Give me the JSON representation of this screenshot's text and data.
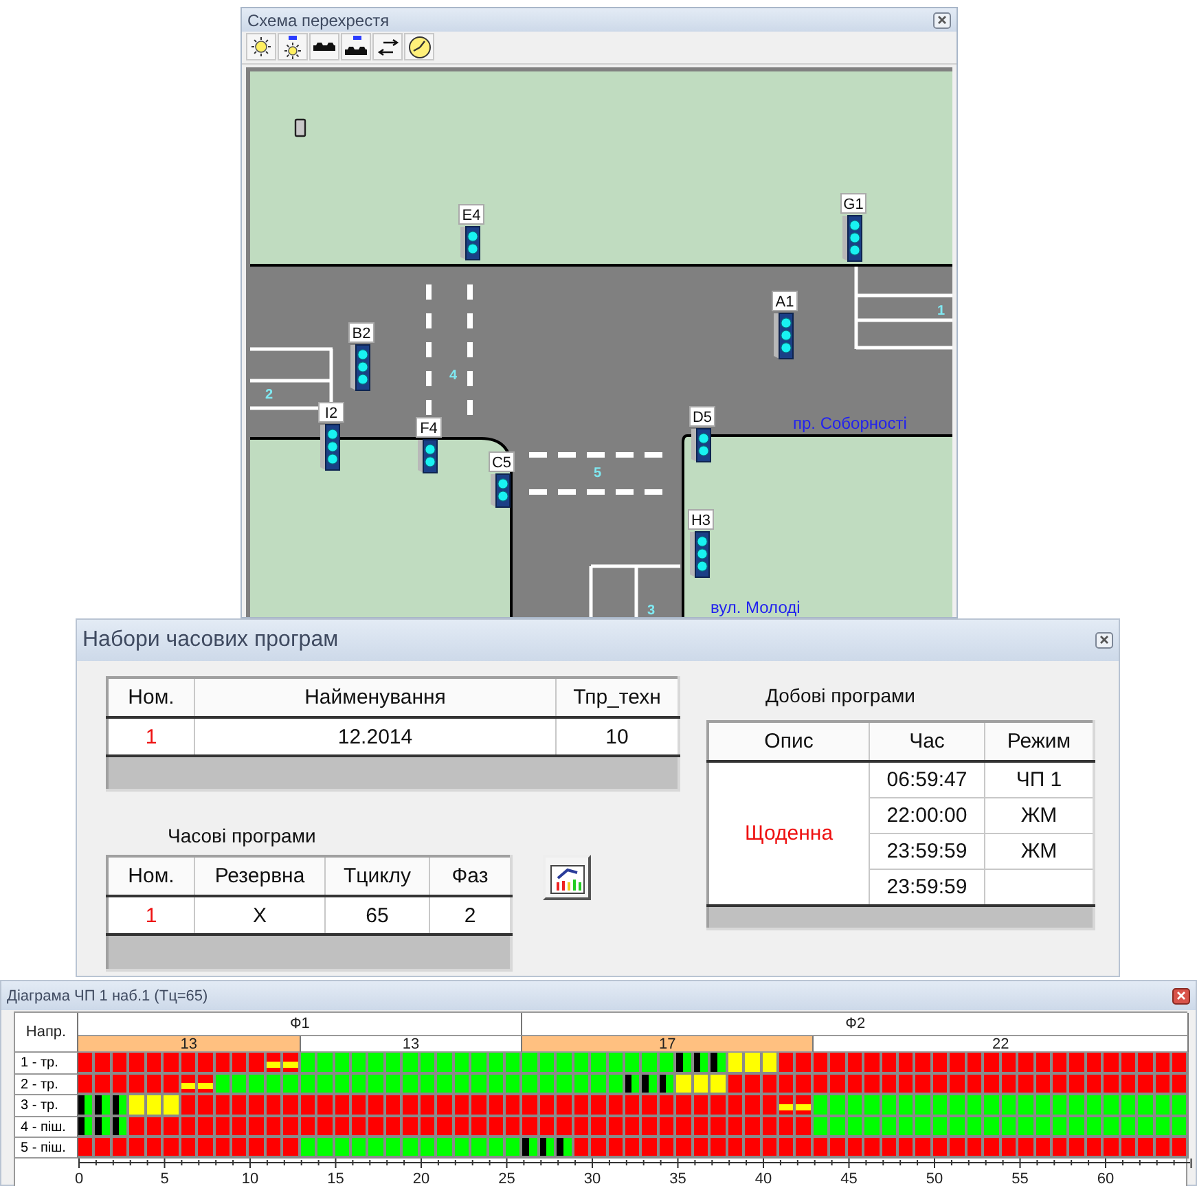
{
  "intersection_window": {
    "title": "Схема перехрестя",
    "toolbar": [
      {
        "kind": "sun"
      },
      {
        "kind": "sunlabeled"
      },
      {
        "kind": "cars"
      },
      {
        "kind": "carslabeled"
      },
      {
        "kind": "swap"
      },
      {
        "kind": "clock"
      }
    ],
    "map": {
      "lanes": [
        "1",
        "2",
        "3",
        "4",
        "5"
      ],
      "streets": [
        "пр. Соборності",
        "вул. Молоді"
      ],
      "signals": [
        {
          "label": "G1",
          "kind": "vehicle"
        },
        {
          "label": "E4",
          "kind": "pedestrian"
        },
        {
          "label": "A1",
          "kind": "vehicle"
        },
        {
          "label": "B2",
          "kind": "vehicle"
        },
        {
          "label": "I2",
          "kind": "vehicle"
        },
        {
          "label": "D5",
          "kind": "pedestrian"
        },
        {
          "label": "F4",
          "kind": "pedestrian"
        },
        {
          "label": "C5",
          "kind": "pedestrian"
        },
        {
          "label": "H3",
          "kind": "vehicle"
        }
      ]
    }
  },
  "programs_window": {
    "title": "Набори часових програм",
    "sets_table": {
      "columns": [
        "Ном.",
        "Найменування",
        "Тпр_техн"
      ],
      "rows": [
        [
          "1",
          "12.2014",
          "10"
        ]
      ]
    },
    "time_programs": {
      "title": "Часові програми",
      "columns": [
        "Ном.",
        "Резервна",
        "Тциклу",
        "Фаз"
      ],
      "rows": [
        [
          "1",
          "X",
          "65",
          "2"
        ]
      ]
    },
    "daily_programs": {
      "title": "Добові програми",
      "columns": [
        "Опис",
        "Час",
        "Режим"
      ],
      "description": "Щоденна",
      "rows": [
        {
          "time": "06:59:47",
          "mode": "ЧП 1"
        },
        {
          "time": "22:00:00",
          "mode": "ЖМ"
        },
        {
          "time": "23:59:59",
          "mode": "ЖМ"
        },
        {
          "time": "23:59:59"
        }
      ]
    }
  },
  "diagram_window": {
    "title": "Діаграма ЧП 1 наб.1 (Тц=65)",
    "direction_header": "Напр.",
    "phases": [
      {
        "label": "Ф1",
        "segments": [
          {
            "label": "13",
            "kind": "intermediate"
          },
          {
            "label": "13",
            "kind": "main"
          }
        ]
      },
      {
        "label": "Ф2",
        "segments": [
          {
            "label": "17",
            "kind": "intermediate"
          },
          {
            "label": "22",
            "kind": "main"
          }
        ]
      }
    ],
    "directions": [
      {
        "label": "1 - тр.",
        "cells": [
          {
            "kind": "red"
          },
          {
            "kind": "red"
          },
          {
            "kind": "red"
          },
          {
            "kind": "red"
          },
          {
            "kind": "red"
          },
          {
            "kind": "red"
          },
          {
            "kind": "red"
          },
          {
            "kind": "red"
          },
          {
            "kind": "red"
          },
          {
            "kind": "red"
          },
          {
            "kind": "red"
          },
          {
            "kind": "redyellow"
          },
          {
            "kind": "redyellow"
          },
          {
            "kind": "green"
          },
          {
            "kind": "green"
          },
          {
            "kind": "green"
          },
          {
            "kind": "green"
          },
          {
            "kind": "green"
          },
          {
            "kind": "green"
          },
          {
            "kind": "green"
          },
          {
            "kind": "green"
          },
          {
            "kind": "green"
          },
          {
            "kind": "green"
          },
          {
            "kind": "green"
          },
          {
            "kind": "green"
          },
          {
            "kind": "green"
          },
          {
            "kind": "green"
          },
          {
            "kind": "green"
          },
          {
            "kind": "green"
          },
          {
            "kind": "green"
          },
          {
            "kind": "green"
          },
          {
            "kind": "green"
          },
          {
            "kind": "green"
          },
          {
            "kind": "green"
          },
          {
            "kind": "green"
          },
          {
            "kind": "flash"
          },
          {
            "kind": "flash"
          },
          {
            "kind": "flash"
          },
          {
            "kind": "yellow"
          },
          {
            "kind": "yellow"
          },
          {
            "kind": "yellow"
          },
          {
            "kind": "red"
          },
          {
            "kind": "red"
          },
          {
            "kind": "red"
          },
          {
            "kind": "red"
          },
          {
            "kind": "red"
          },
          {
            "kind": "red"
          },
          {
            "kind": "red"
          },
          {
            "kind": "red"
          },
          {
            "kind": "red"
          },
          {
            "kind": "red"
          },
          {
            "kind": "red"
          },
          {
            "kind": "red"
          },
          {
            "kind": "red"
          },
          {
            "kind": "red"
          },
          {
            "kind": "red"
          },
          {
            "kind": "red"
          },
          {
            "kind": "red"
          },
          {
            "kind": "red"
          },
          {
            "kind": "red"
          },
          {
            "kind": "red"
          },
          {
            "kind": "red"
          },
          {
            "kind": "red"
          },
          {
            "kind": "red"
          },
          {
            "kind": "red"
          }
        ]
      },
      {
        "label": "2 - тр.",
        "cells": [
          {
            "kind": "red"
          },
          {
            "kind": "red"
          },
          {
            "kind": "red"
          },
          {
            "kind": "red"
          },
          {
            "kind": "red"
          },
          {
            "kind": "red"
          },
          {
            "kind": "redyellow"
          },
          {
            "kind": "redyellow"
          },
          {
            "kind": "green"
          },
          {
            "kind": "green"
          },
          {
            "kind": "green"
          },
          {
            "kind": "green"
          },
          {
            "kind": "green"
          },
          {
            "kind": "green"
          },
          {
            "kind": "green"
          },
          {
            "kind": "green"
          },
          {
            "kind": "green"
          },
          {
            "kind": "green"
          },
          {
            "kind": "green"
          },
          {
            "kind": "green"
          },
          {
            "kind": "green"
          },
          {
            "kind": "green"
          },
          {
            "kind": "green"
          },
          {
            "kind": "green"
          },
          {
            "kind": "green"
          },
          {
            "kind": "green"
          },
          {
            "kind": "green"
          },
          {
            "kind": "green"
          },
          {
            "kind": "green"
          },
          {
            "kind": "green"
          },
          {
            "kind": "green"
          },
          {
            "kind": "green"
          },
          {
            "kind": "flash"
          },
          {
            "kind": "flash"
          },
          {
            "kind": "flash"
          },
          {
            "kind": "yellow"
          },
          {
            "kind": "yellow"
          },
          {
            "kind": "yellow"
          },
          {
            "kind": "red"
          },
          {
            "kind": "red"
          },
          {
            "kind": "red"
          },
          {
            "kind": "red"
          },
          {
            "kind": "red"
          },
          {
            "kind": "red"
          },
          {
            "kind": "red"
          },
          {
            "kind": "red"
          },
          {
            "kind": "red"
          },
          {
            "kind": "red"
          },
          {
            "kind": "red"
          },
          {
            "kind": "red"
          },
          {
            "kind": "red"
          },
          {
            "kind": "red"
          },
          {
            "kind": "red"
          },
          {
            "kind": "red"
          },
          {
            "kind": "red"
          },
          {
            "kind": "red"
          },
          {
            "kind": "red"
          },
          {
            "kind": "red"
          },
          {
            "kind": "red"
          },
          {
            "kind": "red"
          },
          {
            "kind": "red"
          },
          {
            "kind": "red"
          },
          {
            "kind": "red"
          },
          {
            "kind": "red"
          },
          {
            "kind": "red"
          }
        ]
      },
      {
        "label": "3 - тр.",
        "cells": [
          {
            "kind": "flash"
          },
          {
            "kind": "flash"
          },
          {
            "kind": "flash"
          },
          {
            "kind": "yellow"
          },
          {
            "kind": "yellow"
          },
          {
            "kind": "yellow"
          },
          {
            "kind": "red"
          },
          {
            "kind": "red"
          },
          {
            "kind": "red"
          },
          {
            "kind": "red"
          },
          {
            "kind": "red"
          },
          {
            "kind": "red"
          },
          {
            "kind": "red"
          },
          {
            "kind": "red"
          },
          {
            "kind": "red"
          },
          {
            "kind": "red"
          },
          {
            "kind": "red"
          },
          {
            "kind": "red"
          },
          {
            "kind": "red"
          },
          {
            "kind": "red"
          },
          {
            "kind": "red"
          },
          {
            "kind": "red"
          },
          {
            "kind": "red"
          },
          {
            "kind": "red"
          },
          {
            "kind": "red"
          },
          {
            "kind": "red"
          },
          {
            "kind": "red"
          },
          {
            "kind": "red"
          },
          {
            "kind": "red"
          },
          {
            "kind": "red"
          },
          {
            "kind": "red"
          },
          {
            "kind": "red"
          },
          {
            "kind": "red"
          },
          {
            "kind": "red"
          },
          {
            "kind": "red"
          },
          {
            "kind": "red"
          },
          {
            "kind": "red"
          },
          {
            "kind": "red"
          },
          {
            "kind": "red"
          },
          {
            "kind": "red"
          },
          {
            "kind": "red"
          },
          {
            "kind": "redyellow"
          },
          {
            "kind": "redyellow"
          },
          {
            "kind": "green"
          },
          {
            "kind": "green"
          },
          {
            "kind": "green"
          },
          {
            "kind": "green"
          },
          {
            "kind": "green"
          },
          {
            "kind": "green"
          },
          {
            "kind": "green"
          },
          {
            "kind": "green"
          },
          {
            "kind": "green"
          },
          {
            "kind": "green"
          },
          {
            "kind": "green"
          },
          {
            "kind": "green"
          },
          {
            "kind": "green"
          },
          {
            "kind": "green"
          },
          {
            "kind": "green"
          },
          {
            "kind": "green"
          },
          {
            "kind": "green"
          },
          {
            "kind": "green"
          },
          {
            "kind": "green"
          },
          {
            "kind": "green"
          },
          {
            "kind": "green"
          },
          {
            "kind": "green"
          }
        ]
      },
      {
        "label": "4 - піш.",
        "cells": [
          {
            "kind": "flash"
          },
          {
            "kind": "flash"
          },
          {
            "kind": "flash"
          },
          {
            "kind": "red"
          },
          {
            "kind": "red"
          },
          {
            "kind": "red"
          },
          {
            "kind": "red"
          },
          {
            "kind": "red"
          },
          {
            "kind": "red"
          },
          {
            "kind": "red"
          },
          {
            "kind": "red"
          },
          {
            "kind": "red"
          },
          {
            "kind": "red"
          },
          {
            "kind": "red"
          },
          {
            "kind": "red"
          },
          {
            "kind": "red"
          },
          {
            "kind": "red"
          },
          {
            "kind": "red"
          },
          {
            "kind": "red"
          },
          {
            "kind": "red"
          },
          {
            "kind": "red"
          },
          {
            "kind": "red"
          },
          {
            "kind": "red"
          },
          {
            "kind": "red"
          },
          {
            "kind": "red"
          },
          {
            "kind": "red"
          },
          {
            "kind": "red"
          },
          {
            "kind": "red"
          },
          {
            "kind": "red"
          },
          {
            "kind": "red"
          },
          {
            "kind": "red"
          },
          {
            "kind": "red"
          },
          {
            "kind": "red"
          },
          {
            "kind": "red"
          },
          {
            "kind": "red"
          },
          {
            "kind": "red"
          },
          {
            "kind": "red"
          },
          {
            "kind": "red"
          },
          {
            "kind": "red"
          },
          {
            "kind": "red"
          },
          {
            "kind": "red"
          },
          {
            "kind": "red"
          },
          {
            "kind": "red"
          },
          {
            "kind": "green"
          },
          {
            "kind": "green"
          },
          {
            "kind": "green"
          },
          {
            "kind": "green"
          },
          {
            "kind": "green"
          },
          {
            "kind": "green"
          },
          {
            "kind": "green"
          },
          {
            "kind": "green"
          },
          {
            "kind": "green"
          },
          {
            "kind": "green"
          },
          {
            "kind": "green"
          },
          {
            "kind": "green"
          },
          {
            "kind": "green"
          },
          {
            "kind": "green"
          },
          {
            "kind": "green"
          },
          {
            "kind": "green"
          },
          {
            "kind": "green"
          },
          {
            "kind": "green"
          },
          {
            "kind": "green"
          },
          {
            "kind": "green"
          },
          {
            "kind": "green"
          },
          {
            "kind": "green"
          }
        ]
      },
      {
        "label": "5 - піш.",
        "cells": [
          {
            "kind": "red"
          },
          {
            "kind": "red"
          },
          {
            "kind": "red"
          },
          {
            "kind": "red"
          },
          {
            "kind": "red"
          },
          {
            "kind": "red"
          },
          {
            "kind": "red"
          },
          {
            "kind": "red"
          },
          {
            "kind": "red"
          },
          {
            "kind": "red"
          },
          {
            "kind": "red"
          },
          {
            "kind": "red"
          },
          {
            "kind": "red"
          },
          {
            "kind": "green"
          },
          {
            "kind": "green"
          },
          {
            "kind": "green"
          },
          {
            "kind": "green"
          },
          {
            "kind": "green"
          },
          {
            "kind": "green"
          },
          {
            "kind": "green"
          },
          {
            "kind": "green"
          },
          {
            "kind": "green"
          },
          {
            "kind": "green"
          },
          {
            "kind": "green"
          },
          {
            "kind": "green"
          },
          {
            "kind": "green"
          },
          {
            "kind": "flash"
          },
          {
            "kind": "flash"
          },
          {
            "kind": "flash"
          },
          {
            "kind": "red"
          },
          {
            "kind": "red"
          },
          {
            "kind": "red"
          },
          {
            "kind": "red"
          },
          {
            "kind": "red"
          },
          {
            "kind": "red"
          },
          {
            "kind": "red"
          },
          {
            "kind": "red"
          },
          {
            "kind": "red"
          },
          {
            "kind": "red"
          },
          {
            "kind": "red"
          },
          {
            "kind": "red"
          },
          {
            "kind": "red"
          },
          {
            "kind": "red"
          },
          {
            "kind": "red"
          },
          {
            "kind": "red"
          },
          {
            "kind": "red"
          },
          {
            "kind": "red"
          },
          {
            "kind": "red"
          },
          {
            "kind": "red"
          },
          {
            "kind": "red"
          },
          {
            "kind": "red"
          },
          {
            "kind": "red"
          },
          {
            "kind": "red"
          },
          {
            "kind": "red"
          },
          {
            "kind": "red"
          },
          {
            "kind": "red"
          },
          {
            "kind": "red"
          },
          {
            "kind": "red"
          },
          {
            "kind": "red"
          },
          {
            "kind": "red"
          },
          {
            "kind": "red"
          },
          {
            "kind": "red"
          },
          {
            "kind": "red"
          },
          {
            "kind": "red"
          },
          {
            "kind": "red"
          }
        ]
      }
    ],
    "axis_labels": [
      "0",
      "5",
      "10",
      "15",
      "20",
      "25",
      "30",
      "35",
      "40",
      "45",
      "50",
      "55",
      "60"
    ]
  }
}
